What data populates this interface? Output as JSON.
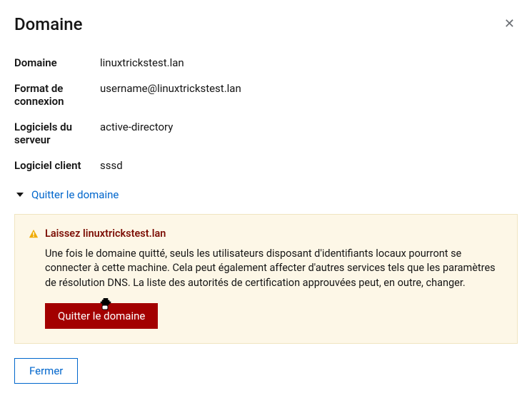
{
  "header": {
    "title": "Domaine"
  },
  "details": {
    "domain_label": "Domaine",
    "domain_value": "linuxtrickstest.lan",
    "format_label": "Format de connexion",
    "format_value": "username@linuxtrickstest.lan",
    "server_label": "Logiciels du serveur",
    "server_value": "active-directory",
    "client_label": "Logiciel client",
    "client_value": "sssd"
  },
  "expand": {
    "label": "Quitter le domaine"
  },
  "warning": {
    "title": "Laissez linuxtrickstest.lan",
    "text": "Une fois le domaine quitté, seuls les utilisateurs disposant d'identifiants locaux pourront se connecter à cette machine. Cela peut également affecter d'autres services tels que les paramètres de résolution DNS. La liste des autorités de certification approuvées peut, en outre, changer.",
    "button": "Quitter le domaine"
  },
  "footer": {
    "close": "Fermer"
  }
}
